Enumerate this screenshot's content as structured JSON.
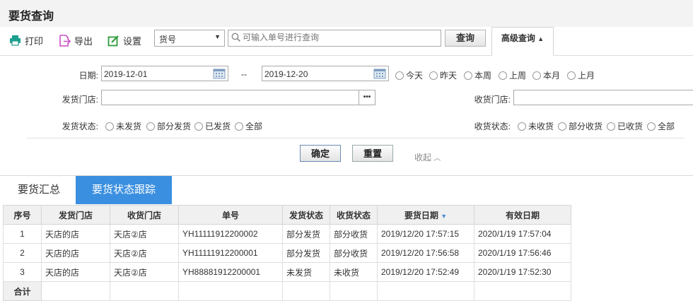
{
  "page_title": "要货查询",
  "toolbar": {
    "print_label": "打印",
    "export_label": "导出",
    "settings_label": "设置",
    "select_value": "货号",
    "search_placeholder": "可输入单号进行查询",
    "query_label": "查询",
    "advanced_label": "高级查询"
  },
  "filters": {
    "date_label": "日期:",
    "date_from": "2019-12-01",
    "date_sep": "--",
    "date_to": "2019-12-20",
    "quick_dates": [
      "今天",
      "昨天",
      "本周",
      "上周",
      "本月",
      "上月"
    ],
    "send_store_label": "发货门店:",
    "send_store_more": "•••",
    "recv_store_label": "收货门店:",
    "send_status_label": "发货状态:",
    "send_status_options": [
      "未发货",
      "部分发货",
      "已发货",
      "全部"
    ],
    "recv_status_label": "收货状态:",
    "recv_status_options": [
      "未收货",
      "部分收货",
      "已收货",
      "全部"
    ],
    "confirm_label": "确定",
    "reset_label": "重置",
    "collapse_label": "收起"
  },
  "tabs": [
    {
      "label": "要货汇总",
      "active": false
    },
    {
      "label": "要货状态跟踪",
      "active": true
    }
  ],
  "table": {
    "headers": [
      "序号",
      "发货门店",
      "收货门店",
      "单号",
      "发货状态",
      "收货状态",
      "要货日期",
      "有效日期"
    ],
    "sorted_column": "要货日期",
    "rows": [
      [
        "1",
        "天店的店",
        "天店②店",
        "YH11111912200002",
        "部分发货",
        "部分收货",
        "2019/12/20 17:57:15",
        "2020/1/19 17:57:04"
      ],
      [
        "2",
        "天店的店",
        "天店②店",
        "YH11111912200001",
        "部分发货",
        "部分收货",
        "2019/12/20 17:56:58",
        "2020/1/19 17:56:46"
      ],
      [
        "3",
        "天店的店",
        "天店②店",
        "YH88881912200001",
        "未发货",
        "未收货",
        "2019/12/20 17:52:49",
        "2020/1/19 17:52:30"
      ]
    ],
    "total_label": "合计"
  },
  "colors": {
    "accent": "#3b8fe0",
    "print_icon": "#1a9e8f",
    "export_icon": "#c94fc4",
    "settings_icon": "#2e9b3a"
  }
}
